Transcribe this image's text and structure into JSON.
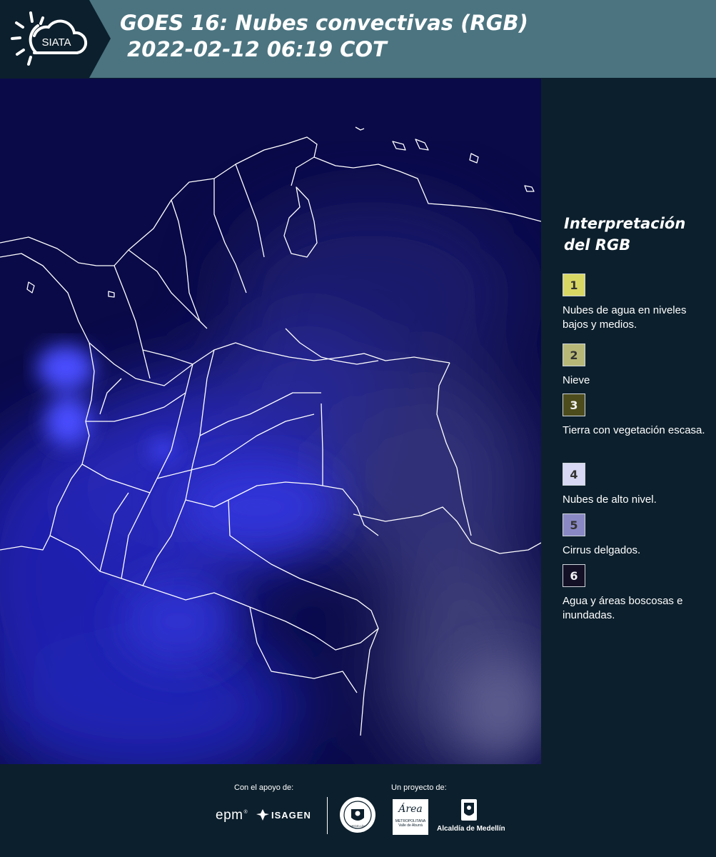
{
  "header": {
    "logo_text": "SIATA",
    "title": "GOES 16: Nubes convectivas (RGB)\n 2022-02-12 06:19 COT"
  },
  "legend": {
    "title": "Interpretación\ndel RGB",
    "items": [
      {
        "num": "1",
        "color": "#d9d764",
        "text": "Nubes de agua en niveles bajos y medios."
      },
      {
        "num": "2",
        "color": "#b7b877",
        "text": "Nieve"
      },
      {
        "num": "3",
        "color": "#4d4c1c",
        "text": "Tierra con vegetación escasa."
      },
      {
        "num": "4",
        "color": "#d8d8f4",
        "text": "Nubes de alto nivel."
      },
      {
        "num": "5",
        "color": "#8a88c4",
        "text": "Cirrus delgados."
      },
      {
        "num": "6",
        "color": "#130f24",
        "text": "Agua y áreas boscosas e inundadas."
      }
    ]
  },
  "footer": {
    "support_label": "Con el apoyo de:",
    "project_label": "Un proyecto de:",
    "epm": "epm",
    "isagen": "ISAGEN",
    "area_logo": "Área",
    "area_sub1": "METROPOLITANA",
    "area_sub2": "Valle de Aburrá",
    "alcaldia": "Alcaldía de Medellín",
    "medellin_seal": "MEDELLÍN"
  },
  "colors": {
    "header": "#4b7480",
    "background": "#0c1f2c",
    "map_base": "#0a0a48",
    "cloud_bright": "#3a3cff",
    "cloud_gray": "#5a5aa0",
    "borders": "#ffffff"
  },
  "icons": [
    "sun-cloud-logo",
    "epm-logo",
    "isagen-logo",
    "medellin-seal",
    "area-metropolitana-logo",
    "alcaldia-logo"
  ]
}
